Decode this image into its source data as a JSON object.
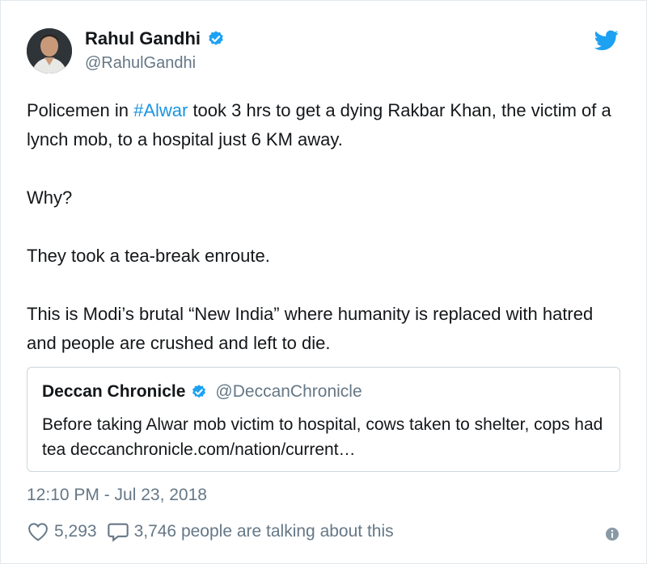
{
  "author": {
    "display_name": "Rahul Gandhi",
    "handle": "@RahulGandhi",
    "verified_icon": "verified-badge-icon"
  },
  "tweet": {
    "line1_pre": "Policemen in ",
    "hashtag": "#Alwar",
    "line1_post": " took 3 hrs to get a dying Rakbar Khan, the victim of a lynch mob, to a hospital just 6 KM away.",
    "para2": "Why?",
    "para3": "They took a tea-break enroute.",
    "para4": "This is Modi’s brutal “New India” where humanity is replaced with hatred and people are crushed and left to die."
  },
  "quoted": {
    "display_name": "Deccan Chronicle",
    "handle": "@DeccanChronicle",
    "text": "Before taking Alwar mob victim to hospital, cows taken to shelter, cops had tea deccanchronicle.com/nation/current…"
  },
  "timestamp": "12:10 PM - Jul 23, 2018",
  "stats": {
    "likes": "5,293",
    "talking": "3,746 people are talking about this"
  },
  "colors": {
    "link": "#1b95e0",
    "muted": "#657786",
    "border": "#ccd6dd",
    "twitter_blue": "#1da1f2"
  }
}
